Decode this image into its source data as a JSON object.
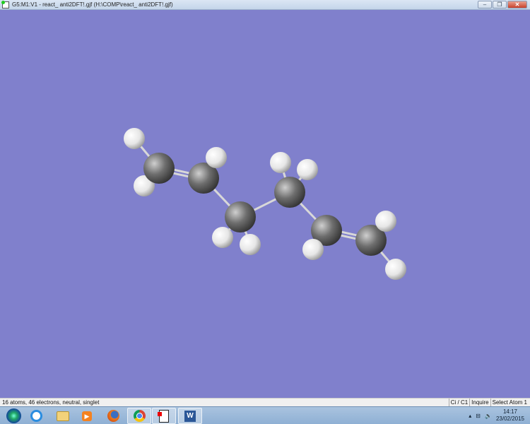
{
  "window": {
    "title": "G5:M1:V1 - react_ anti2DFT!.gjf (H:\\COMP\\react_ anti2DFT!.gjf)",
    "minimize": "–",
    "restore": "❐",
    "close": "✕"
  },
  "status": {
    "left": "16 atoms, 46 electrons, neutral, singlet",
    "layer": "Ci / C1",
    "mode": "Inquire",
    "prompt": "Select Atom 1"
  },
  "taskbar": {
    "apps": [
      "start",
      "internet-explorer",
      "file-explorer",
      "media-player",
      "firefox",
      "chrome",
      "gaussview",
      "word"
    ]
  },
  "tray": {
    "time": "14:17",
    "date": "23/02/2015",
    "show_hidden": "▴"
  },
  "colors": {
    "background": "#8080cc",
    "carbon": "#6e6e6e",
    "hydrogen": "#f0f0f0"
  }
}
